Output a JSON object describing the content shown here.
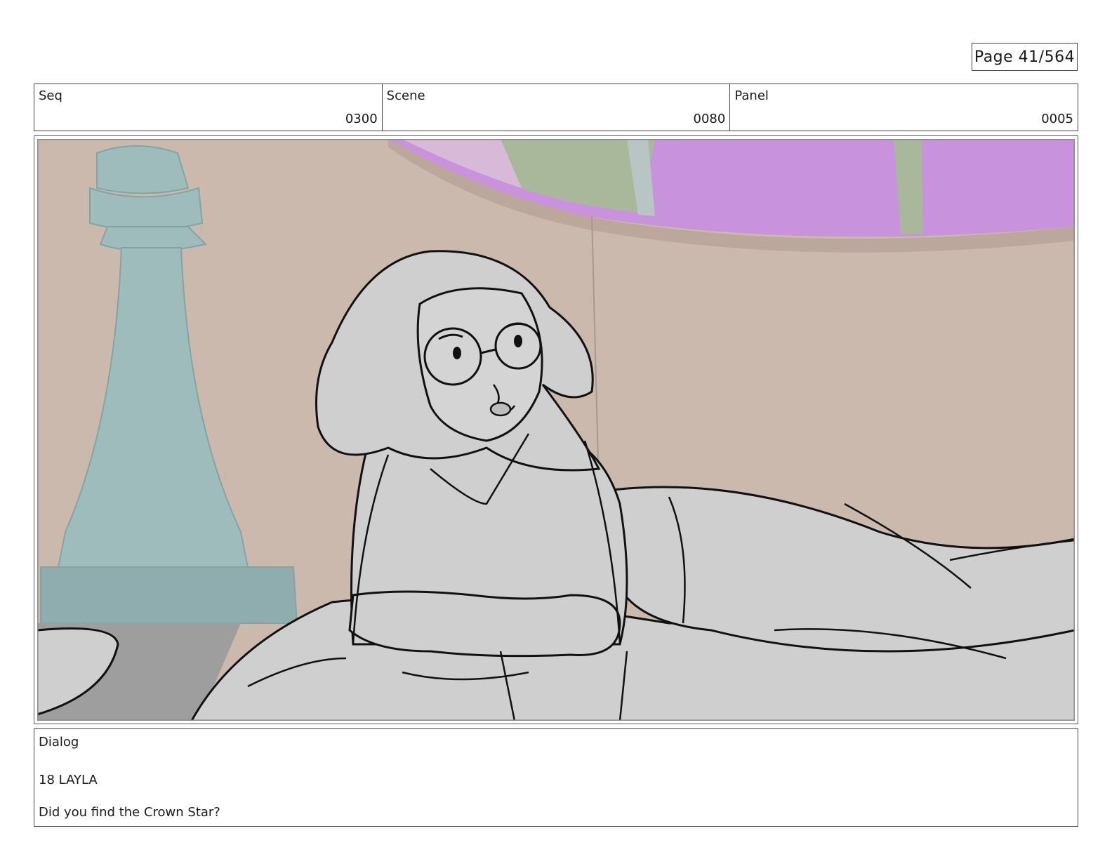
{
  "page": {
    "label": "Page",
    "number": "41/564",
    "text": "Page  41/564"
  },
  "header": {
    "seq": {
      "label": "Seq",
      "value": "0300"
    },
    "scene": {
      "label": "Scene",
      "value": "0080"
    },
    "panel": {
      "label": "Panel",
      "value": "0005"
    }
  },
  "frame": {
    "description_icon": "storyboard-panel-image"
  },
  "dialog": {
    "label": "Dialog",
    "lines": [
      "18 LAYLA",
      "Did you find the Crown Star?"
    ]
  },
  "colors": {
    "wall": "#cbb9ae",
    "window_pink": "#c893dc",
    "pillar": "#9fbcbd",
    "sketch_fill": "#cfcfcf",
    "floor": "#9e9e9e"
  }
}
